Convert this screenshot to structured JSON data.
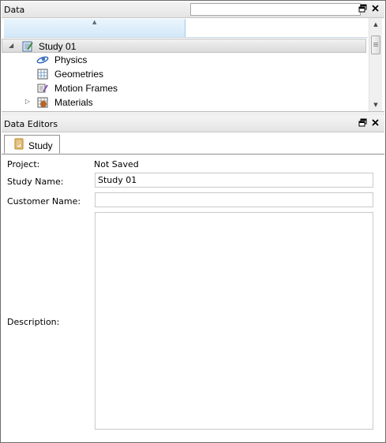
{
  "data_panel": {
    "title": "Data",
    "search": {
      "value": "",
      "placeholder": ""
    },
    "restore_icon": "restore-window-icon",
    "close_icon": "close-icon",
    "tree": [
      {
        "label": "Study 01",
        "icon": "study-icon",
        "expanded": true,
        "selected": true
      },
      {
        "label": "Physics",
        "icon": "physics-icon"
      },
      {
        "label": "Geometries",
        "icon": "geometries-icon"
      },
      {
        "label": "Motion Frames",
        "icon": "motion-frames-icon"
      },
      {
        "label": "Materials",
        "icon": "materials-icon",
        "expanded": false
      }
    ]
  },
  "editors_panel": {
    "title": "Data Editors",
    "restore_icon": "restore-window-icon",
    "close_icon": "close-icon",
    "tabs": [
      {
        "label": "Study",
        "icon": "study-tab-icon",
        "active": true
      }
    ]
  },
  "study_form": {
    "project_label": "Project:",
    "project_value": "Not Saved",
    "study_name_label": "Study Name:",
    "study_name_value": "Study 01",
    "customer_name_label": "Customer Name:",
    "customer_name_value": "",
    "description_label": "Description:",
    "description_value": ""
  },
  "colors": {
    "header_bg": "#e9e9e9",
    "column_header_bg": "#d3e8f8",
    "border": "#c9c9c9"
  }
}
